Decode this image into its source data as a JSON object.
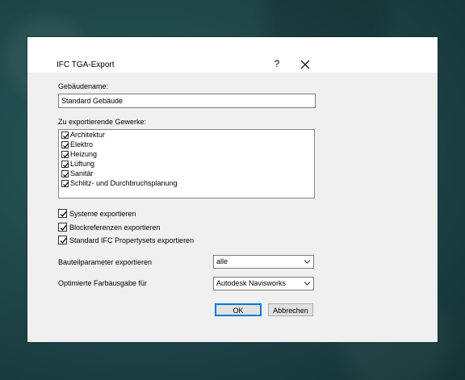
{
  "dialog": {
    "title": "IFC TGA-Export",
    "help": "?",
    "building_name_label": "Gebäudename:",
    "building_name_value": "Standard Gebäude",
    "trades_label": "Zu exportierende Gewerke:",
    "trades": [
      {
        "label": "Architektur",
        "checked": true
      },
      {
        "label": "Elektro",
        "checked": true
      },
      {
        "label": "Heizung",
        "checked": true
      },
      {
        "label": "Lüftung",
        "checked": true
      },
      {
        "label": "Sanitär",
        "checked": true
      },
      {
        "label": "Schlitz- und Durchbruchsplanung",
        "checked": true
      }
    ],
    "options": [
      {
        "label": "Systeme exportieren",
        "checked": true
      },
      {
        "label": "Blockreferenzen exportieren",
        "checked": true
      },
      {
        "label": "Standard IFC Propertysets exportieren",
        "checked": true
      }
    ],
    "component_params_label": "Bauteilparameter exportieren",
    "component_params_value": "alle",
    "color_output_label": "Optimierte Farbausgabe für",
    "color_output_value": "Autodesk Navisworks",
    "ok_label": "OK",
    "cancel_label": "Abbrechen"
  },
  "colors": {
    "dialog_bg": "#f0f0f0",
    "default_button_border": "#0078d7",
    "background": "#1d4346"
  }
}
